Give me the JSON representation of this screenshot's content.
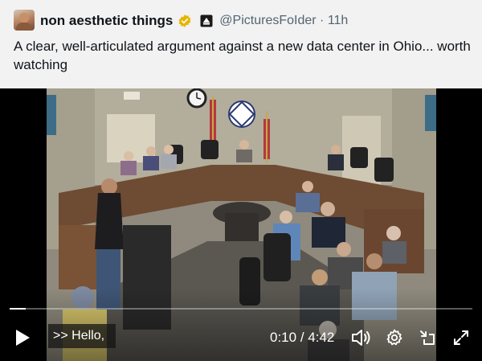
{
  "tweet": {
    "display_name": "non aesthetic things",
    "handle": "@PicturesFoIder",
    "separator": "·",
    "time": "11h",
    "text": "A clear, well-articulated argument against a new data center in Ohio... worth watching",
    "verified_color": "#e8b400",
    "affiliate_icon": "org-badge-icon"
  },
  "video": {
    "caption": ">> Hello,",
    "current_time": "0:10",
    "duration": "4:42",
    "time_separator": " / ",
    "progress": 0.035,
    "controls": [
      "play-icon",
      "volume-icon",
      "settings-gear-icon",
      "minimize-icon",
      "fullscreen-icon"
    ]
  }
}
